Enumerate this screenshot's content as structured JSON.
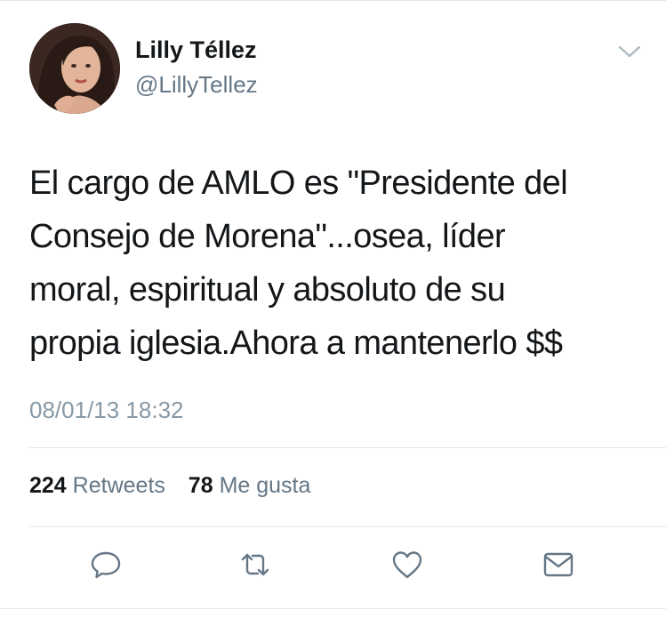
{
  "user": {
    "name": "Lilly Téllez",
    "handle": "@LillyTellez"
  },
  "tweet": {
    "lines": [
      "El cargo de AMLO es \"Presidente del",
      "Consejo de Morena\"...osea, líder",
      "moral, espiritual y absoluto de su",
      "propia iglesia.Ahora a mantenerlo $$"
    ],
    "timestamp": "08/01/13 18:32"
  },
  "stats": {
    "retweets_count": "224",
    "retweets_label": "Retweets",
    "likes_count": "78",
    "likes_label": "Me gusta"
  },
  "icons": {
    "reply": "reply-icon",
    "retweet": "retweet-icon",
    "like": "heart-icon",
    "message": "direct-message-icon",
    "menu": "chevron-down-icon"
  },
  "colors": {
    "text": "#14171a",
    "secondary": "#657786",
    "timestamp": "#8899a6",
    "icon": "#657786",
    "divider": "#e1e8ed"
  }
}
